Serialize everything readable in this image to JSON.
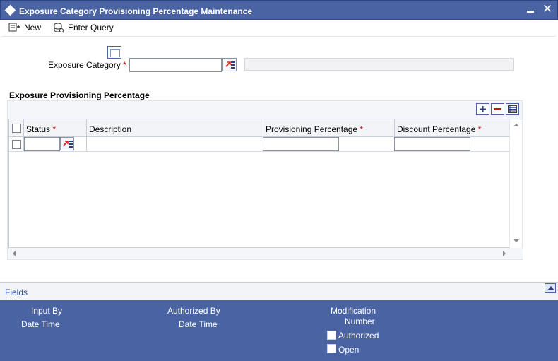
{
  "window": {
    "title": "Exposure Category Provisioning Percentage Maintenance",
    "close_glyph": "✕"
  },
  "toolbar": {
    "new_label": "New",
    "enter_query_label": "Enter Query"
  },
  "form": {
    "exposure_category_label": "Exposure Category",
    "required_marker": "*",
    "exposure_category_value": ""
  },
  "section": {
    "title": "Exposure Provisioning Percentage"
  },
  "grid": {
    "columns": [
      {
        "label": "Status",
        "required": "*"
      },
      {
        "label": "Description",
        "required": ""
      },
      {
        "label": "Provisioning Percentage",
        "required": "*"
      },
      {
        "label": "Discount Percentage",
        "required": "*"
      }
    ],
    "rows": [
      {
        "status": "",
        "description": "",
        "provisioning_percentage": "",
        "discount_percentage": ""
      }
    ]
  },
  "footer": {
    "fields_label": "Fields",
    "input_by": "Input By",
    "date_time_1": "Date Time",
    "authorized_by": "Authorized By",
    "date_time_2": "Date Time",
    "modification": "Modification",
    "number": "Number",
    "authorized": "Authorized",
    "open": "Open"
  },
  "colors": {
    "title_bar": "#4a64a3",
    "required": "#cc0000",
    "link": "#2a4a9c"
  },
  "icons": [
    "diamond-icon",
    "minimize-icon",
    "close-icon",
    "new-icon",
    "enter-query-icon",
    "calendar-icon",
    "lov-icon",
    "add-row-icon",
    "delete-row-icon",
    "single-view-icon",
    "expand-up-icon"
  ]
}
